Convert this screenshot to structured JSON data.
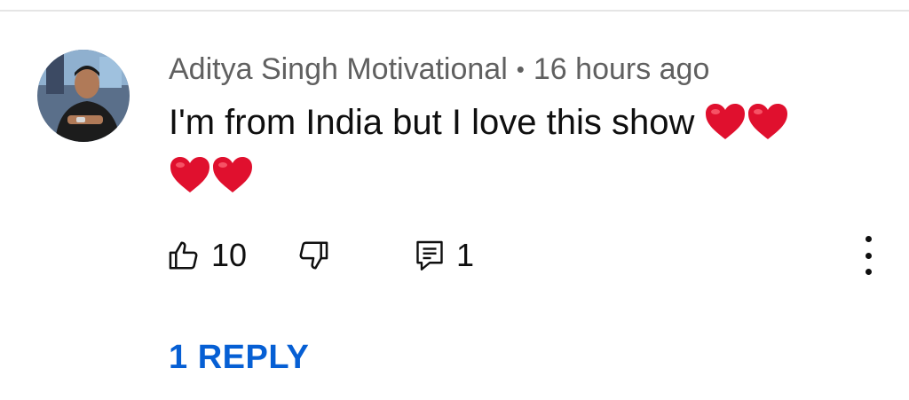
{
  "comment": {
    "author": "Aditya Singh Motivational",
    "separator": "•",
    "timestamp": "16 hours ago",
    "text": "I'm from India but I love this show",
    "emoji_hearts": 4
  },
  "actions": {
    "like_count": "10",
    "reply_count": "1"
  },
  "replies": {
    "label": "1 REPLY"
  },
  "icons": {
    "like": "thumbs-up-icon",
    "dislike": "thumbs-down-icon",
    "reply": "comment-icon",
    "more": "more-vertical-icon",
    "heart": "red-heart-emoji"
  },
  "colors": {
    "link": "#065fd4",
    "meta_text": "#606060",
    "text": "#0f0f0f",
    "heart": "#e0102e"
  }
}
